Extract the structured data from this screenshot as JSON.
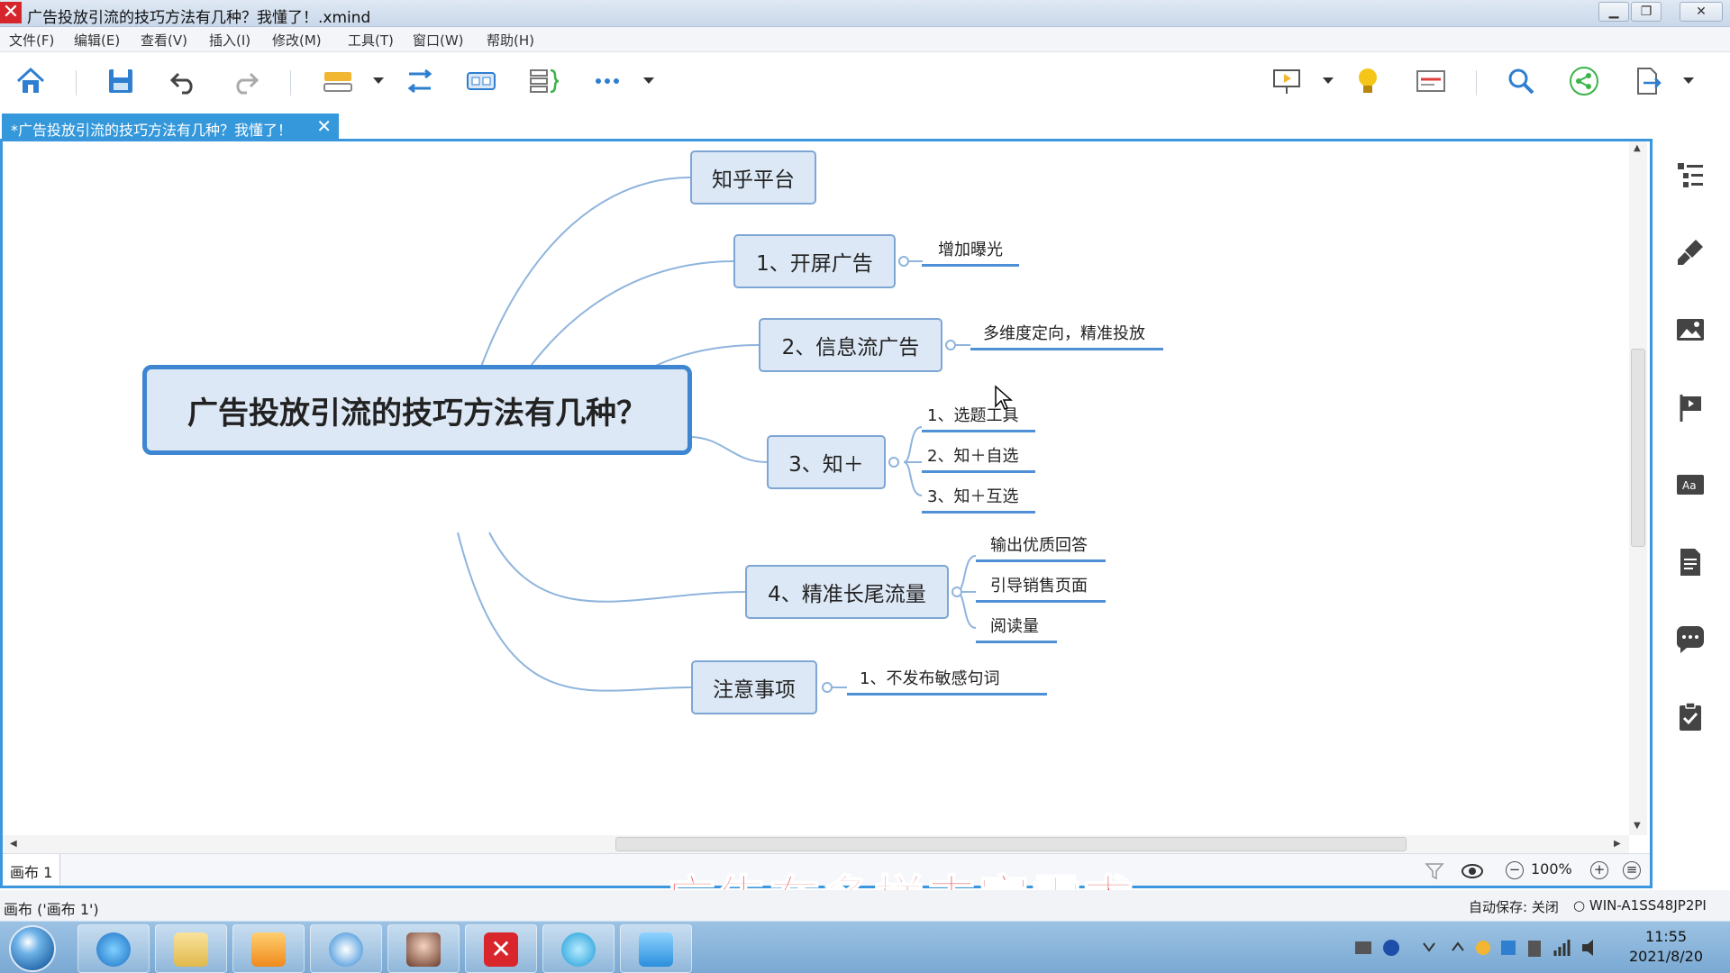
{
  "window": {
    "title": "广告投放引流的技巧方法有几种？我懂了！.xmind",
    "controls": [
      "minimize",
      "restore",
      "close"
    ]
  },
  "menu": [
    "文件(F)",
    "编辑(E)",
    "查看(V)",
    "插入(I)",
    "修改(M)",
    "工具(T)",
    "窗口(W)",
    "帮助(H)"
  ],
  "toolbar": {
    "left_icons": [
      "home-icon",
      "save-icon",
      "undo-icon",
      "redo-icon",
      "insert-topic-icon",
      "relationship-icon",
      "boundary-icon",
      "summary-icon",
      "more-icon"
    ],
    "right_icons": [
      "presentation-icon",
      "brainstorm-bulb-icon",
      "outline-icon",
      "search-icon",
      "share-icon",
      "export-icon"
    ]
  },
  "tab": {
    "label": "*广告投放引流的技巧方法有几种？我懂了！",
    "close": "✕"
  },
  "mindmap": {
    "central": "广告投放引流的技巧方法有几种？",
    "branches": [
      {
        "label": "知乎平台",
        "children": []
      },
      {
        "label": "1、开屏广告",
        "children": [
          "增加曝光"
        ]
      },
      {
        "label": "2、信息流广告",
        "children": [
          "多维度定向，精准投放"
        ]
      },
      {
        "label": "3、知＋",
        "children": [
          "1、选题工具",
          "2、知＋自选",
          "3、知＋互选"
        ]
      },
      {
        "label": "4、精准长尾流量",
        "children": [
          "输出优质回答",
          "引导销售页面",
          "阅读量"
        ]
      },
      {
        "label": "注意事项",
        "children": [
          "1、不发布敏感句词"
        ]
      }
    ]
  },
  "sheet": {
    "tab": "画布 1",
    "zoom": "100%"
  },
  "status": {
    "left": "画布 ('画布 1')",
    "autosave": "自动保存: 关闭",
    "host": "WIN-A1SS48JP2PI"
  },
  "subtitle": "广告在多样丰富需求",
  "side_panel_icons": [
    "outline-panel-icon",
    "format-brush-icon",
    "image-icon",
    "marker-flag-icon",
    "text-style-icon",
    "notes-icon",
    "comment-icon",
    "task-icon"
  ],
  "taskbar": {
    "apps": [
      "internet-explorer-icon",
      "file-explorer-icon",
      "media-player-icon",
      "browser-icon",
      "photo-app-icon",
      "xmind-icon",
      "chat-app-icon",
      "video-app-icon"
    ],
    "clock_time": "11:55",
    "clock_date": "2021/8/20"
  },
  "colors": {
    "accent": "#3a96dd",
    "topic_fill": "#dde8f6",
    "topic_border": "#7ea6d4",
    "subtitle": "#e02a2a"
  }
}
